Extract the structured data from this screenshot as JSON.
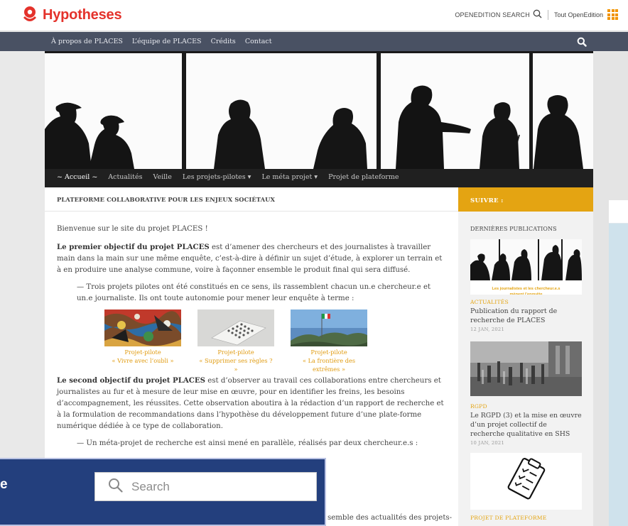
{
  "openedition": {
    "brand": "Hypotheses",
    "search_label": "OPENEDITION SEARCH",
    "all_label": "Tout OpenEdition"
  },
  "blog_nav": [
    "À propos de PLACES",
    "L’équipe de PLACES",
    "Crédits",
    "Contact"
  ],
  "main_menu": [
    {
      "label": "~ Accueil ~",
      "active": true
    },
    {
      "label": "Actualités",
      "active": false
    },
    {
      "label": "Veille",
      "active": false
    },
    {
      "label": "Les projets-pilotes ▾",
      "active": false
    },
    {
      "label": "Le méta projet ▾",
      "active": false
    },
    {
      "label": "Projet de plateforme",
      "active": false
    }
  ],
  "page": {
    "heading": "PLATEFORME COLLABORATIVE POUR LES ENJEUX SOCIÉTAUX",
    "welcome": "Bienvenue sur le site du projet PLACES !",
    "obj1_bold": "Le premier objectif du projet PLACES",
    "obj1_rest": " est d’amener des chercheurs et des journalistes à travailler main dans la main sur une même enquête, c’est-à-dire à définir un sujet d’étude, à explorer un terrain et à en produire une analyse commune, voire à façonner ensemble le produit final qui sera diffusé.",
    "pilots_intro": "— Trois projets pilotes ont été constitués en ce sens, ils rassemblent chacun un.e chercheur.e et un.e journaliste. Ils ont toute autonomie pour mener leur enquête à terme :",
    "pilots": [
      {
        "line1": "Projet-pilote",
        "line2": "« Vivre avec l’oubli »"
      },
      {
        "line1": "Projet-pilote",
        "line2": "« Supprimer ses règles ? »"
      },
      {
        "line1": "Projet-pilote",
        "line2": "« La frontière des extrêmes »"
      }
    ],
    "obj2_bold": "Le second objectif du projet PLACES",
    "obj2_rest": " est d’observer au travail ces collaborations entre chercheurs et journalistes au fur et à mesure de leur mise en œuvre, pour en identifier les freins, les besoins d’accompagnement, les réussites. Cette observation aboutira à la rédaction d’un rapport de recherche et à la formulation de recommandations dans l’hypothèse du développement future d’une plate-forme numérique dédiée à ce type de collaboration.",
    "meta_intro": "— Un méta-projet de recherche est ainsi mené en parallèle, réalisés par deux chercheur.e.s :",
    "tail": "semble des actualités des projets-"
  },
  "sidebar": {
    "heading": "SUIVRE :",
    "label": "DERNIÈRES PUBLICATIONS",
    "posts": [
      {
        "img_caption": "Les journalistes et les chercheur.e.s mènent l’enquête",
        "category": "ACTUALITÉS",
        "title": "Publication du rapport de recherche de PLACES",
        "date": "12 JAN, 2021"
      },
      {
        "category": "RGPD",
        "title": "Le RGPD (3) et la mise en œuvre d’un projet collectif de recherche qualitative en SHS",
        "date": "10 JAN, 2021"
      },
      {
        "category": "PROJET DE PLATEFORME",
        "title": "",
        "date": ""
      }
    ]
  },
  "overlay": {
    "title": "e",
    "search_placeholder": "Search"
  },
  "colors": {
    "accent": "#e4a412",
    "brand_red": "#e4322b",
    "nav_bg": "#495163",
    "menu_bg": "#202020",
    "overlay_bg": "#233f7d"
  }
}
